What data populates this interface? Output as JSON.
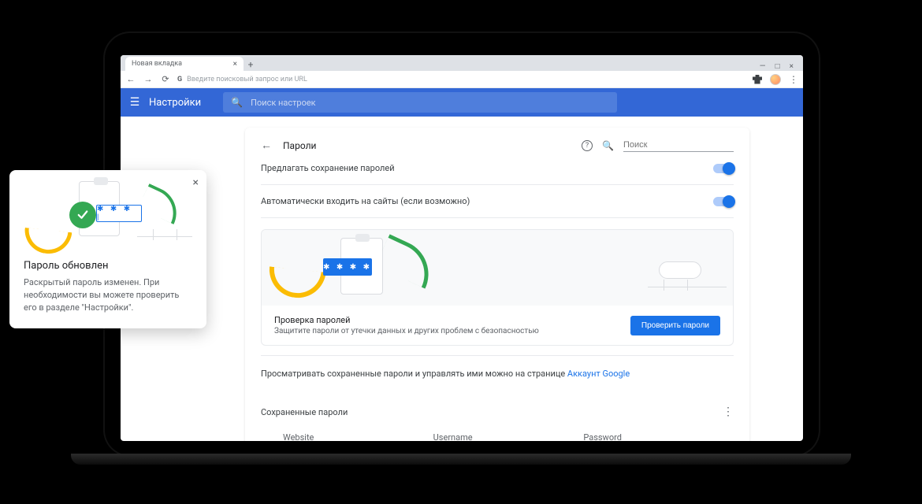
{
  "browser": {
    "tab_title": "Новая вкладка",
    "url_placeholder": "Введите поисковый запрос или URL",
    "window_controls": {
      "min": "—",
      "max": "□",
      "close": "×"
    }
  },
  "settings_header": {
    "title": "Настройки",
    "search_placeholder": "Поиск настроек"
  },
  "panel": {
    "title": "Пароли",
    "search_placeholder": "Поиск",
    "row_offer_save": "Предлагать сохранение паролей",
    "row_auto_signin": "Автоматически входить на сайты (если возможно)",
    "check": {
      "title": "Проверка паролей",
      "subtitle": "Защитите пароли от утечки данных и других проблем с безопасностью",
      "button": "Проверить пароли",
      "chip_text": "✱ ✱ ✱ ✱"
    },
    "manage_text_prefix": "Просматривать сохраненные пароли и управлять ими можно на странице ",
    "manage_link": "Аккаунт Google",
    "saved_section_title": "Сохраненные пароли",
    "table_headers": {
      "website": "Website",
      "username": "Username",
      "password": "Password"
    }
  },
  "toast": {
    "title": "Пароль обновлен",
    "body": "Раскрытый пароль изменен. При необходимости вы можете проверить его в разделе \"Настройки\".",
    "chip_text": "✱ ✱ ✱ |"
  },
  "colors": {
    "primary": "#1a73e8",
    "header": "#3367d6",
    "success": "#34a853",
    "sun": "#fbbc04"
  }
}
